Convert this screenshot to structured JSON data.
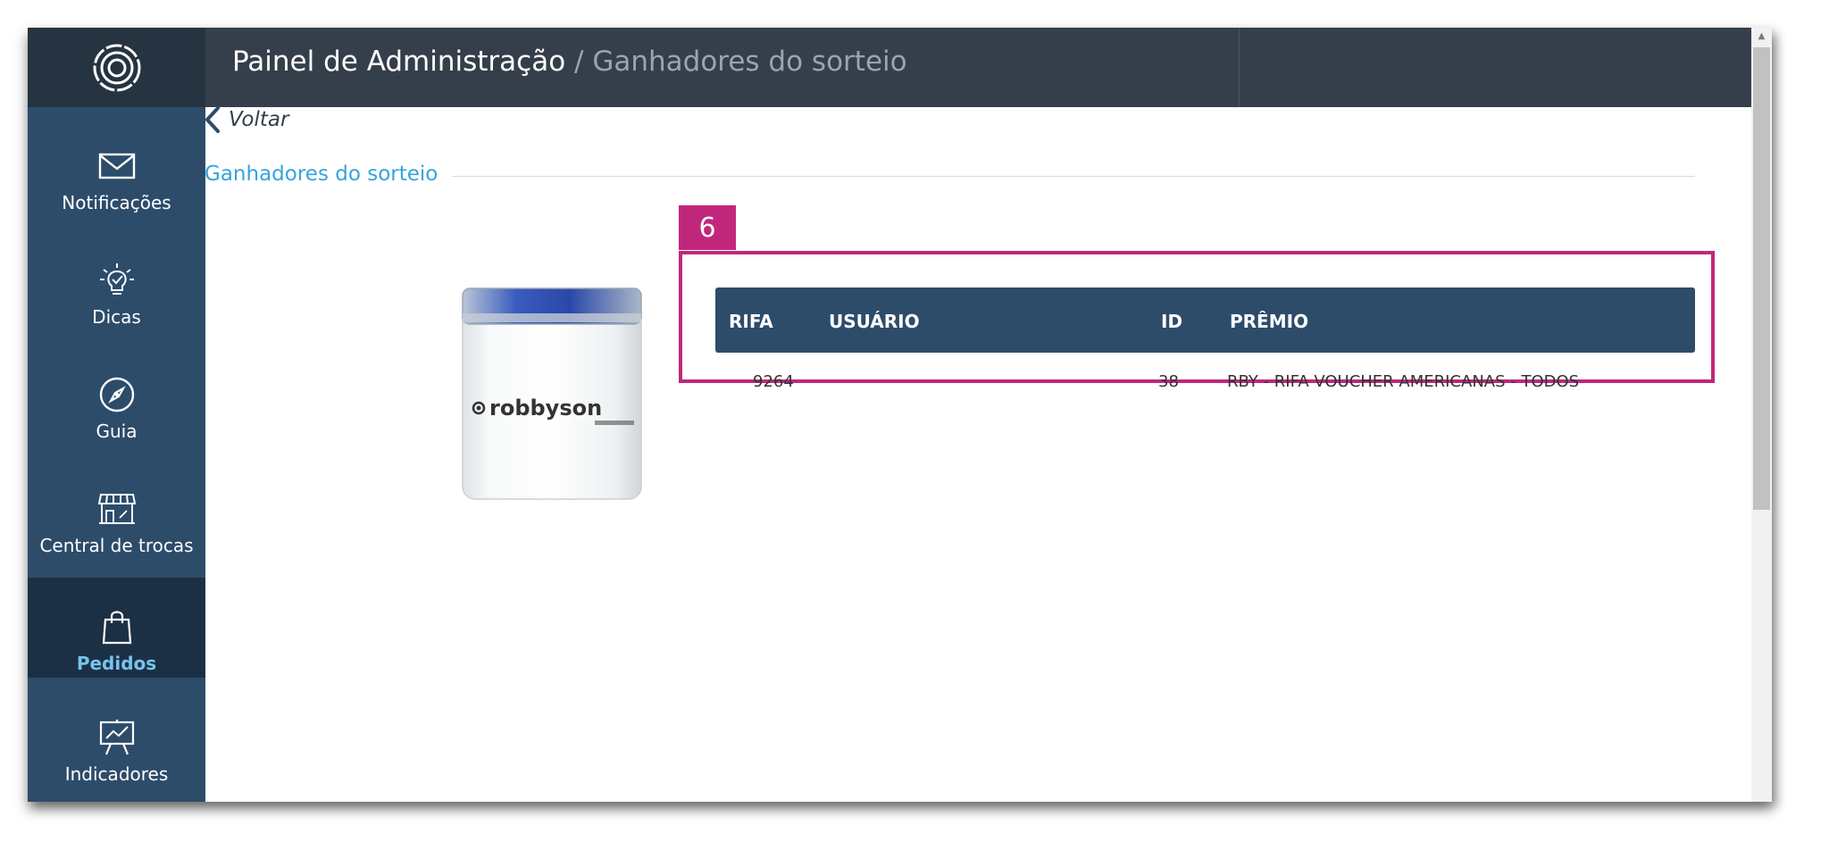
{
  "header": {
    "title": "Painel de Administração",
    "separator": " / ",
    "subtitle": "Ganhadores do sorteio"
  },
  "sidebar": {
    "items": [
      {
        "label": "Notificações",
        "icon": "envelope-icon"
      },
      {
        "label": "Dicas",
        "icon": "lightbulb-icon"
      },
      {
        "label": "Guia",
        "icon": "compass-icon"
      },
      {
        "label": "Central de trocas",
        "icon": "storefront-icon"
      },
      {
        "label": "Pedidos",
        "icon": "shopping-bag-icon",
        "active": true
      },
      {
        "label": "Indicadores",
        "icon": "chart-board-icon"
      }
    ]
  },
  "content": {
    "back_label": "Voltar",
    "section_title": "Ganhadores do sorteio",
    "product_brand": "robbyson",
    "badge": "6",
    "table": {
      "headers": [
        "RIFA",
        "USUÁRIO",
        "ID",
        "PRÊMIO"
      ],
      "rows": [
        {
          "rifa": "9264",
          "usuario": "",
          "id": "38",
          "premio": "RBY - RIFA VOUCHER AMERICANAS - TODOS"
        }
      ]
    }
  },
  "colors": {
    "sidebar": "#2d4c6a",
    "sidebar_active": "#1c3045",
    "header": "#353f4b",
    "accent": "#36a3dd",
    "highlight": "#c0277c"
  }
}
